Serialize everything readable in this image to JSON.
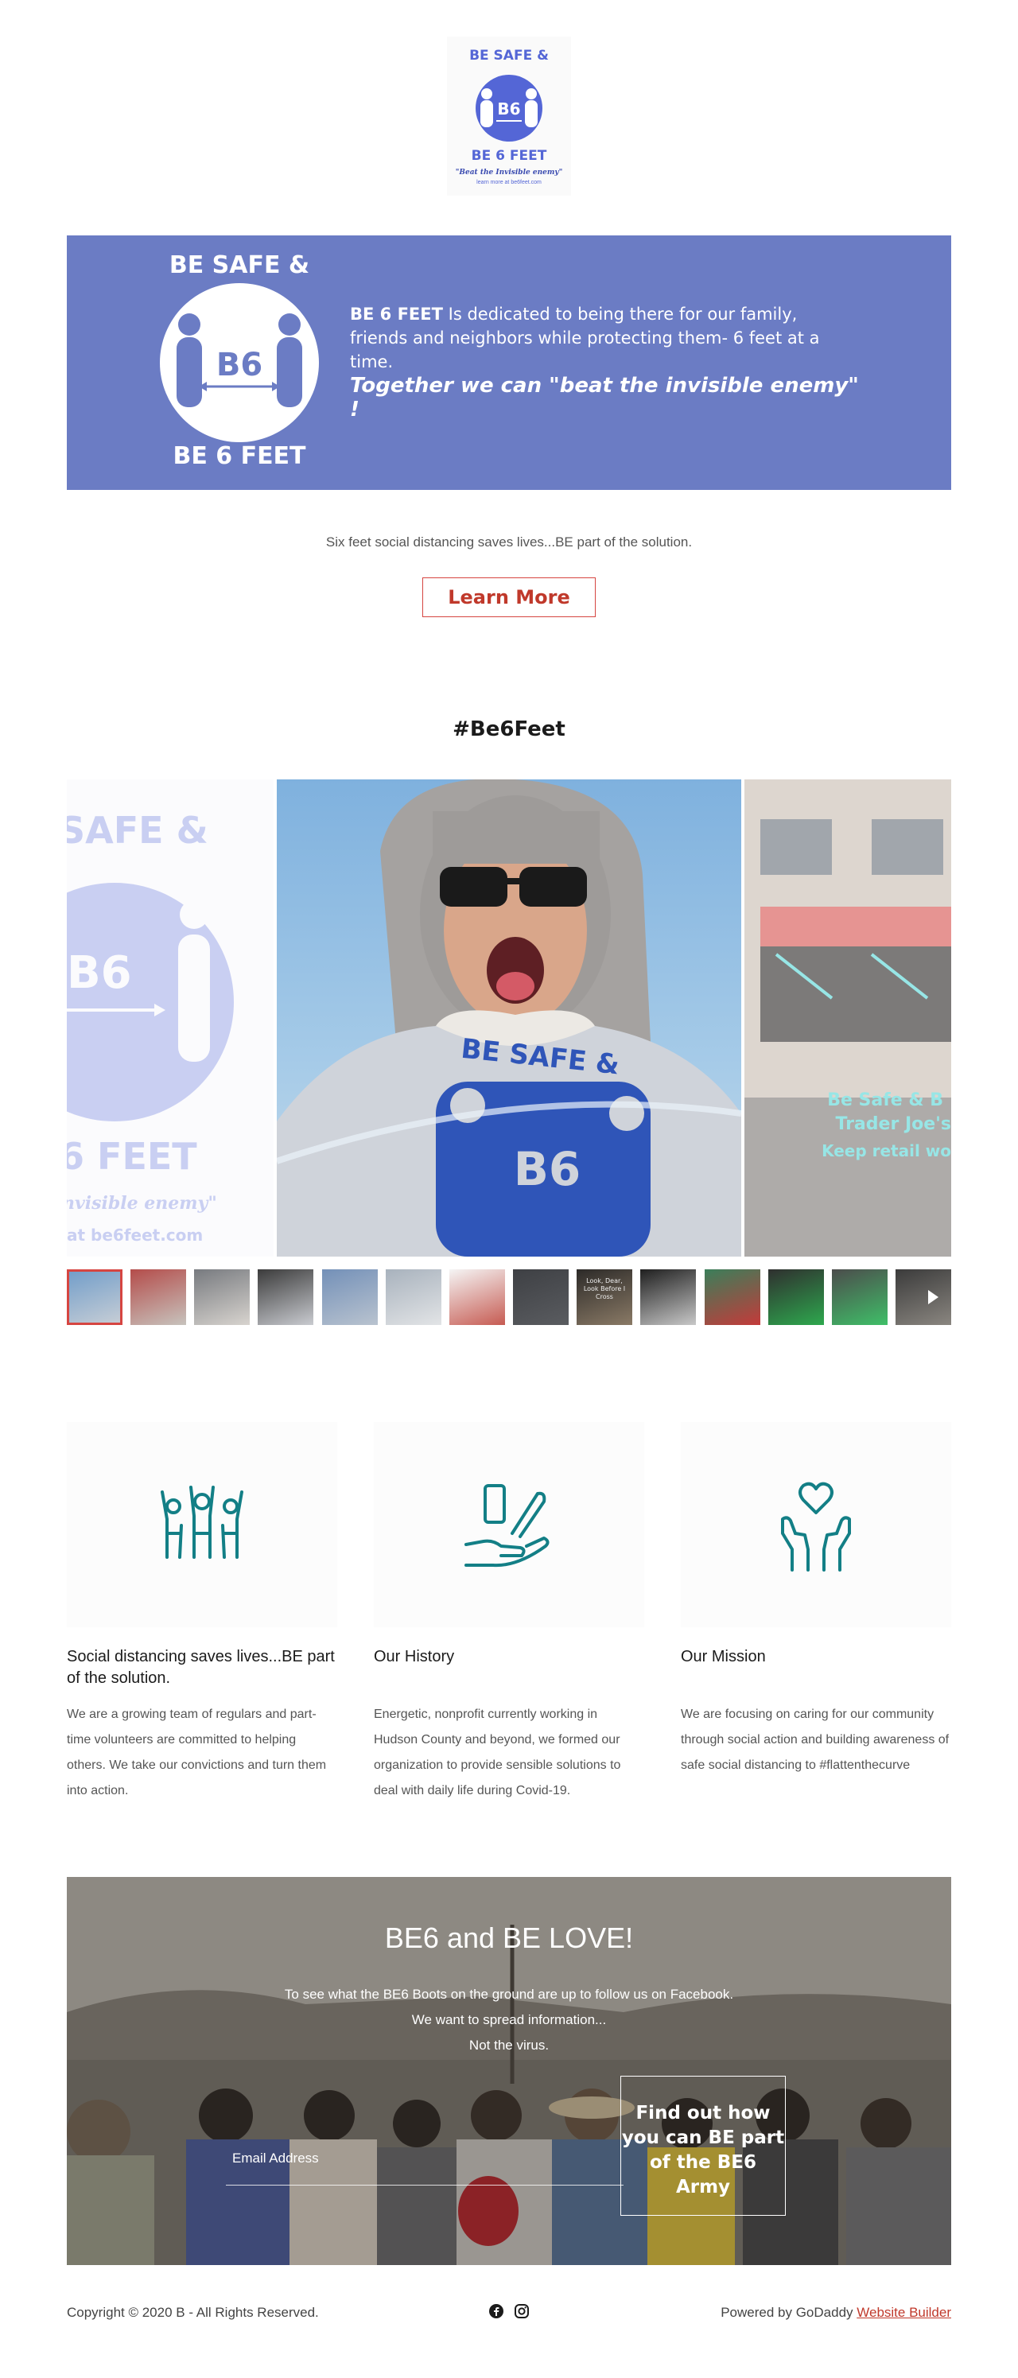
{
  "logo": {
    "line1": "BE SAFE &",
    "center": "B6",
    "line2": "BE 6 FEET",
    "tagline": "\"Beat the Invisible enemy\"",
    "url": "learn more at be6feet.com",
    "colors": {
      "primary": "#5466d6"
    }
  },
  "banner": {
    "top_line": "BE SAFE &",
    "center": "B6",
    "bottom_line": "BE 6 FEET",
    "brand": "BE 6 FEET",
    "description": " Is dedicated to being there for our family, friends and neighbors while protecting them- 6 feet at a time.",
    "quote": "Together we can \"beat the invisible enemy\" !",
    "background": "#6b7cc4"
  },
  "hero": {
    "tagline": "Six feet social distancing saves lives...BE part of the solution.",
    "button_label": "Learn More"
  },
  "gallery": {
    "title": "#Be6Feet",
    "left_slide": {
      "line1": "SAFE &",
      "center": "B6",
      "line2": "6 FEET",
      "tagline": "nvisible enemy\"",
      "url": "at be6feet.com"
    },
    "main_slide": {
      "shirt_line": "BE SAFE &",
      "shirt_center": "B6"
    },
    "right_slide": {
      "line1": "Be Safe & B",
      "line2": "Trader Joe's",
      "line3": "Keep retail wo"
    },
    "thumb_count": 14,
    "active_thumb": 0,
    "thumb_texts": [
      "",
      "",
      "",
      "",
      "",
      "",
      "",
      "",
      "Look, Dear, Look Before I Cross",
      "",
      "",
      "",
      "",
      ""
    ]
  },
  "features": [
    {
      "icon": "people-group-icon",
      "title": "Social distancing saves lives...BE part of the solution.",
      "body": "We are a growing team of regulars and part-time volunteers are committed to helping others. We take our convictions and turn them into action."
    },
    {
      "icon": "hand-donation-icon",
      "title": "Our History",
      "body": "Energetic, nonprofit currently working in Hudson County and beyond, we formed our organization to provide sensible solutions to deal with daily life during Covid-19."
    },
    {
      "icon": "heart-hands-icon",
      "title": "Our Mission",
      "body": "We are focusing on caring for our community through social action and building awareness of safe social distancing to #flattenthecurve"
    }
  ],
  "cta": {
    "title": "BE6 and BE LOVE!",
    "line1": "To see what the BE6 Boots on the ground are up to follow us on Facebook.",
    "line2": "We want to spread information...",
    "line3": "Not the virus.",
    "email_placeholder": "Email Address",
    "button_label": "Find out how you can BE part of the BE6 Army"
  },
  "footer": {
    "copyright": "Copyright © 2020 B - All Rights Reserved.",
    "social": [
      "facebook-icon",
      "instagram-icon"
    ],
    "powered_prefix": "Powered by GoDaddy ",
    "powered_link": "Website Builder",
    "accent": "#c0392b"
  }
}
